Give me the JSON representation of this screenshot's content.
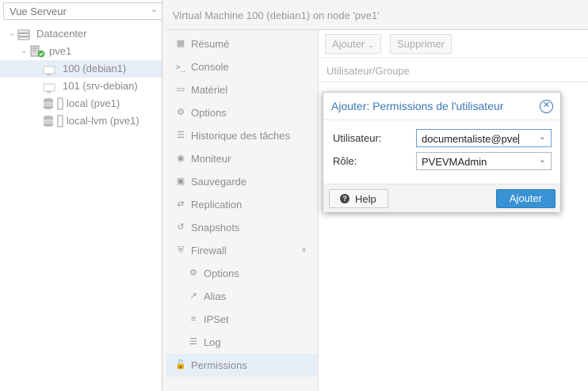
{
  "sidebar": {
    "view_select": "Vue Serveur",
    "tree": [
      {
        "label": "Datacenter",
        "icon": "datacenter-icon"
      },
      {
        "label": "pve1",
        "icon": "node-icon"
      },
      {
        "label": "100 (debian1)",
        "icon": "vm-icon"
      },
      {
        "label": "101 (srv-debian)",
        "icon": "vm-icon"
      },
      {
        "label": "local (pve1)",
        "icon": "storage-icon"
      },
      {
        "label": "local-lvm (pve1)",
        "icon": "storage-icon"
      }
    ]
  },
  "header": {
    "title": "Virtual Machine 100 (debian1) on node 'pve1'"
  },
  "menu": [
    {
      "label": "Résumé",
      "icon": "summary-icon"
    },
    {
      "label": "Console",
      "icon": "terminal-icon"
    },
    {
      "label": "Matériel",
      "icon": "monitor-icon"
    },
    {
      "label": "Options",
      "icon": "gear-icon"
    },
    {
      "label": "Historique des tâches",
      "icon": "list-icon"
    },
    {
      "label": "Moniteur",
      "icon": "eye-icon"
    },
    {
      "label": "Sauvegarde",
      "icon": "floppy-icon"
    },
    {
      "label": "Replication",
      "icon": "retweet-icon"
    },
    {
      "label": "Snapshots",
      "icon": "history-icon"
    },
    {
      "label": "Firewall",
      "icon": "shield-icon"
    },
    {
      "label": "Options",
      "icon": "gear-icon"
    },
    {
      "label": "Alias",
      "icon": "external-link-icon"
    },
    {
      "label": "IPSet",
      "icon": "list-ol-icon"
    },
    {
      "label": "Log",
      "icon": "list-icon"
    },
    {
      "label": "Permissions",
      "icon": "unlock-icon"
    }
  ],
  "toolbar": {
    "add_label": "Ajouter",
    "delete_label": "Supprimer"
  },
  "grid": {
    "column_user_group": "Utilisateur/Groupe"
  },
  "dialog": {
    "title": "Ajouter: Permissions de l'utilisateur",
    "user_label": "Utilisateur:",
    "user_value": "documentaliste@pve",
    "role_label": "Rôle:",
    "role_value": "PVEVMAdmin",
    "help_label": "Help",
    "submit_label": "Ajouter"
  },
  "colors": {
    "accent": "#3892d4",
    "title": "#3c78b5",
    "status_ok": "#4caf50"
  }
}
